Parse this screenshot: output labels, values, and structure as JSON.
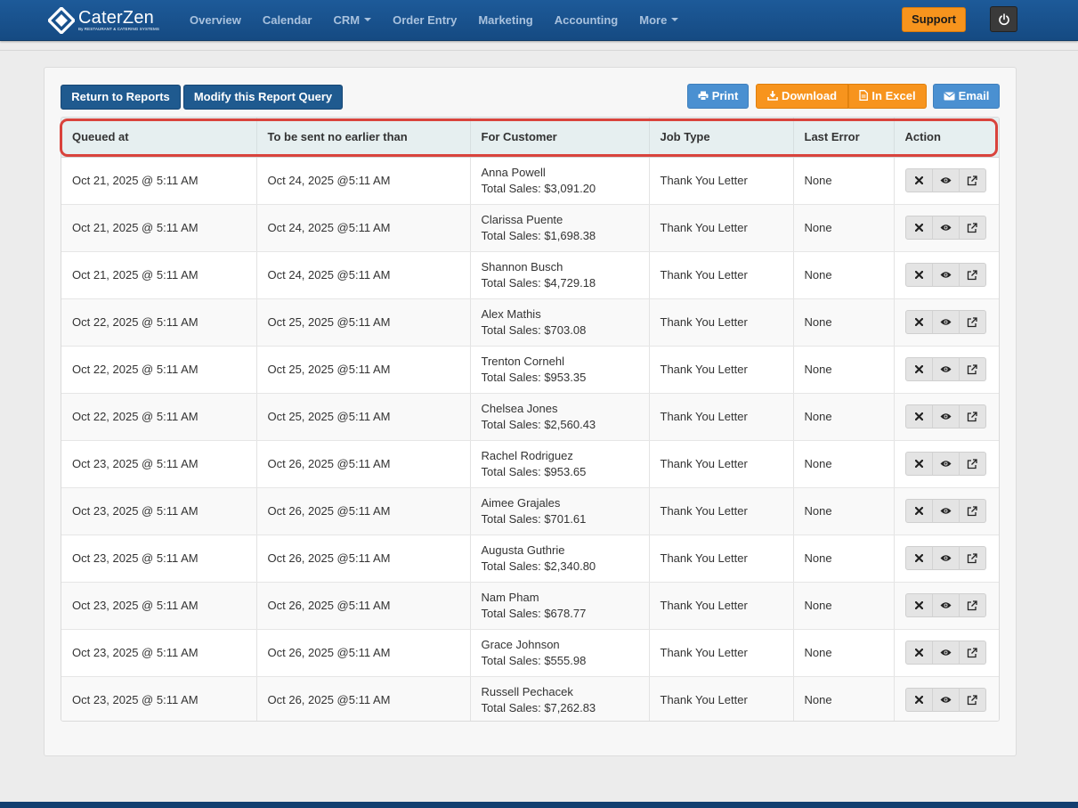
{
  "brand": {
    "name": "CaterZen",
    "subtitle": "By RESTAURANT & CATERING SYSTEMS"
  },
  "nav": {
    "items": [
      {
        "label": "Overview",
        "dropdown": false
      },
      {
        "label": "Calendar",
        "dropdown": false
      },
      {
        "label": "CRM",
        "dropdown": true
      },
      {
        "label": "Order Entry",
        "dropdown": false
      },
      {
        "label": "Marketing",
        "dropdown": false
      },
      {
        "label": "Accounting",
        "dropdown": false
      },
      {
        "label": "More",
        "dropdown": true
      }
    ],
    "support_label": "Support",
    "power_icon": "power-icon"
  },
  "toolbar": {
    "return_label": "Return to Reports",
    "modify_label": "Modify this Report Query",
    "print_label": "Print",
    "download_label": "Download",
    "excel_label": "In Excel",
    "email_label": "Email"
  },
  "table": {
    "headers": [
      "Queued at",
      "To be sent no earlier than",
      "For Customer",
      "Job Type",
      "Last Error",
      "Action"
    ],
    "rows": [
      {
        "queued": "Oct 21, 2025 @ 5:11 AM",
        "send_after": "Oct 24, 2025 @5:11 AM",
        "customer": "Anna Powell",
        "sales": "Total Sales: $3,091.20",
        "job": "Thank You Letter",
        "error": "None"
      },
      {
        "queued": "Oct 21, 2025 @ 5:11 AM",
        "send_after": "Oct 24, 2025 @5:11 AM",
        "customer": "Clarissa Puente",
        "sales": "Total Sales: $1,698.38",
        "job": "Thank You Letter",
        "error": "None"
      },
      {
        "queued": "Oct 21, 2025 @ 5:11 AM",
        "send_after": "Oct 24, 2025 @5:11 AM",
        "customer": "Shannon Busch",
        "sales": "Total Sales: $4,729.18",
        "job": "Thank You Letter",
        "error": "None"
      },
      {
        "queued": "Oct 22, 2025 @ 5:11 AM",
        "send_after": "Oct 25, 2025 @5:11 AM",
        "customer": "Alex Mathis",
        "sales": "Total Sales: $703.08",
        "job": "Thank You Letter",
        "error": "None"
      },
      {
        "queued": "Oct 22, 2025 @ 5:11 AM",
        "send_after": "Oct 25, 2025 @5:11 AM",
        "customer": "Trenton Cornehl",
        "sales": "Total Sales: $953.35",
        "job": "Thank You Letter",
        "error": "None"
      },
      {
        "queued": "Oct 22, 2025 @ 5:11 AM",
        "send_after": "Oct 25, 2025 @5:11 AM",
        "customer": "Chelsea Jones",
        "sales": "Total Sales: $2,560.43",
        "job": "Thank You Letter",
        "error": "None"
      },
      {
        "queued": "Oct 23, 2025 @ 5:11 AM",
        "send_after": "Oct 26, 2025 @5:11 AM",
        "customer": "Rachel Rodriguez",
        "sales": "Total Sales: $953.65",
        "job": "Thank You Letter",
        "error": "None"
      },
      {
        "queued": "Oct 23, 2025 @ 5:11 AM",
        "send_after": "Oct 26, 2025 @5:11 AM",
        "customer": "Aimee Grajales",
        "sales": "Total Sales: $701.61",
        "job": "Thank You Letter",
        "error": "None"
      },
      {
        "queued": "Oct 23, 2025 @ 5:11 AM",
        "send_after": "Oct 26, 2025 @5:11 AM",
        "customer": "Augusta Guthrie",
        "sales": "Total Sales: $2,340.80",
        "job": "Thank You Letter",
        "error": "None"
      },
      {
        "queued": "Oct 23, 2025 @ 5:11 AM",
        "send_after": "Oct 26, 2025 @5:11 AM",
        "customer": "Nam Pham",
        "sales": "Total Sales: $678.77",
        "job": "Thank You Letter",
        "error": "None"
      },
      {
        "queued": "Oct 23, 2025 @ 5:11 AM",
        "send_after": "Oct 26, 2025 @5:11 AM",
        "customer": "Grace Johnson",
        "sales": "Total Sales: $555.98",
        "job": "Thank You Letter",
        "error": "None"
      },
      {
        "queued": "Oct 23, 2025 @ 5:11 AM",
        "send_after": "Oct 26, 2025 @5:11 AM",
        "customer": "Russell Pechacek",
        "sales": "Total Sales: $7,262.83",
        "job": "Thank You Letter",
        "error": "None"
      }
    ],
    "row_actions": [
      "delete-icon",
      "eye-icon",
      "external-link-icon"
    ]
  },
  "colors": {
    "nav_bg": "#1a5490",
    "accent_orange": "#f7941d",
    "accent_blue": "#4a90d1",
    "highlight": "#d9433c"
  }
}
